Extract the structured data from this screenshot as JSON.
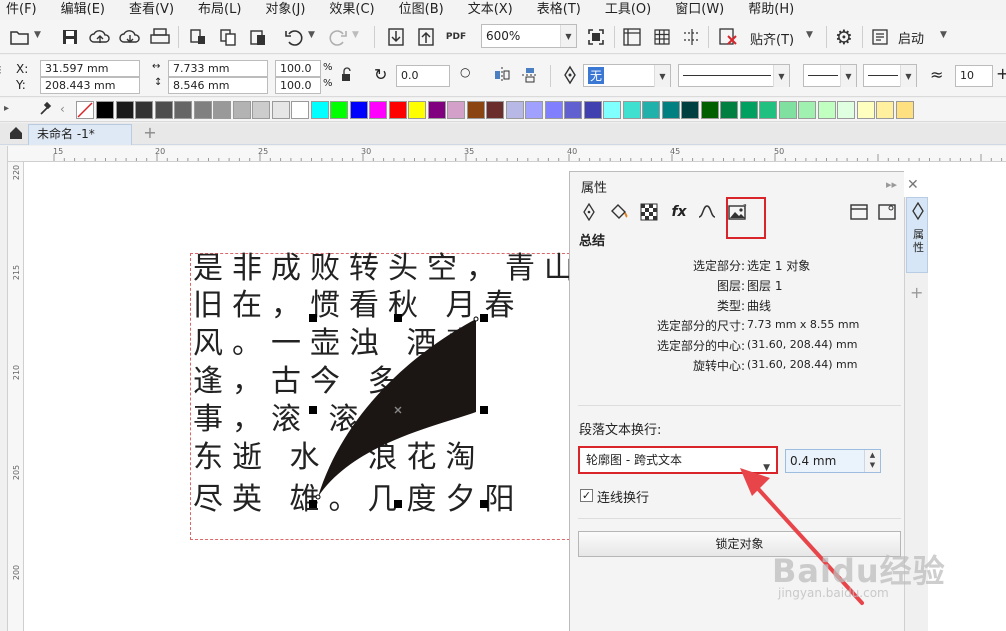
{
  "menu": {
    "items": [
      "件(F)",
      "编辑(E)",
      "查看(V)",
      "布局(L)",
      "对象(J)",
      "效果(C)",
      "位图(B)",
      "文本(X)",
      "表格(T)",
      "工具(O)",
      "窗口(W)",
      "帮助(H)"
    ]
  },
  "toolbar": {
    "zoom_value": "600%",
    "snap_label": "贴齐(T)",
    "launch_label": "启动"
  },
  "property_bar": {
    "x_label": "X:",
    "y_label": "Y:",
    "x_value": "31.597 mm",
    "y_value": "208.443 mm",
    "width_value": "7.733 mm",
    "height_value": "8.546 mm",
    "scale_w": "100.0",
    "scale_h": "100.0",
    "pct": "%",
    "rotation_value": "0.0",
    "outline_fill_value": "无",
    "corner_value": "10"
  },
  "palette": {
    "colors": [
      "#000000",
      "#1a1a1a",
      "#333333",
      "#4d4d4d",
      "#666666",
      "#808080",
      "#999999",
      "#b3b3b3",
      "#cccccc",
      "#e6e6e6",
      "#ffffff",
      "#00ffff",
      "#00ff00",
      "#0000ff",
      "#ff00ff",
      "#ff0000",
      "#ffff00",
      "#800080",
      "#d2a0c8",
      "#8b4513",
      "#6b2c2c",
      "#b8b8e6",
      "#a0a0ff",
      "#8080ff",
      "#6060d0",
      "#4040b0",
      "#80ffff",
      "#40e0d0",
      "#20b2aa",
      "#008080",
      "#004040",
      "#006000",
      "#008040",
      "#00a060",
      "#20c080",
      "#80e0a0",
      "#a0f0b0",
      "#c0ffc0",
      "#e0ffe0",
      "#ffffc0",
      "#fff0a0",
      "#ffe080"
    ]
  },
  "tabs": {
    "document_name": "未命名 -1*"
  },
  "ruler": {
    "h_ticks": [
      "15",
      "20",
      "25",
      "30",
      "35",
      "40",
      "45",
      "50"
    ],
    "v_ticks": [
      "220",
      "215",
      "210",
      "205",
      "200"
    ]
  },
  "document_text": {
    "lines": [
      "是非成败转头空，青山",
      "旧在，惯看秋    月春",
      "风。一壶浊      酒喜",
      "逢，古今        多少",
      "事，滚          滚长",
      "东逝        水，浪花淘",
      "尽英   雄。几度夕阳"
    ]
  },
  "docker": {
    "title": "属性",
    "section_heading": "总结",
    "summary": [
      {
        "label": "选定部分:",
        "value": "选定 1 对象"
      },
      {
        "label": "图层:",
        "value": "图层 1"
      },
      {
        "label": "类型:",
        "value": "曲线"
      },
      {
        "label": "选定部分的尺寸:",
        "value": "7.73 mm x 8.55 mm"
      },
      {
        "label": "选定部分的中心:",
        "value": "(31.60, 208.44) mm"
      },
      {
        "label": "旋转中心:",
        "value": "(31.60, 208.44) mm"
      }
    ],
    "wrap_label": "段落文本换行:",
    "wrap_value": "轮廓图 - 跨式文本",
    "offset_value": "0.4 mm",
    "continuous_label": "连线换行",
    "lock_button": "锁定对象"
  },
  "side_tab": {
    "label": "属性"
  },
  "watermark": {
    "main": "Baidu经验",
    "sub": "jingyan.baidu.com"
  },
  "accent_colors": {
    "highlight_red": "#d9252a",
    "selection_blue": "#d7e6f6"
  }
}
